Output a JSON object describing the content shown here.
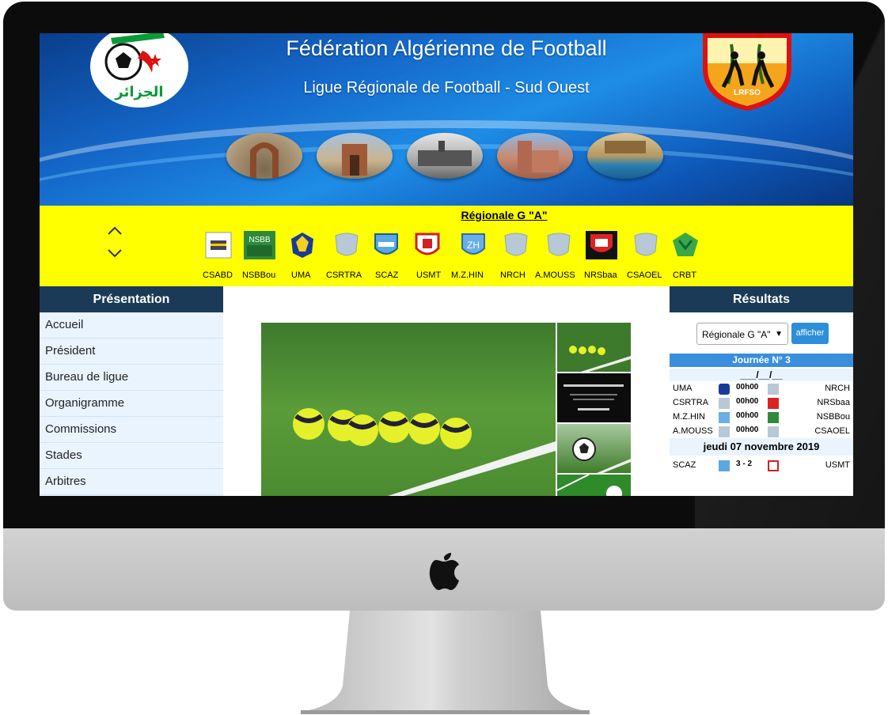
{
  "header": {
    "title": "Fédération Algérienne de Football",
    "subtitle": "Ligue Régionale de Football - Sud Ouest",
    "faf_logo_text": "الجزائر",
    "lrfso_logo_text": "LRFSO"
  },
  "clubs_band": {
    "division_title": "Régionale G \"A\"",
    "clubs": [
      "CSABD",
      "NSBBou",
      "UMA",
      "CSRTRA",
      "SCAZ",
      "USMT",
      "M.Z.HIN",
      "NRCH",
      "A.MOUSS",
      "NRSbaa",
      "CSAOEL",
      "CRBT"
    ]
  },
  "left_menu": {
    "heading": "Présentation",
    "items": [
      "Accueil",
      "Président",
      "Bureau de ligue",
      "Organigramme",
      "Commissions",
      "Stades",
      "Arbitres"
    ]
  },
  "results": {
    "heading": "Résultats",
    "select_value": "Régionale G \"A\"",
    "afficher_label": "afficher",
    "journee": "Journée N° 3",
    "date_blank": "___/__/__",
    "matches": [
      {
        "home": "UMA",
        "score": "00h00",
        "away": "NRCH"
      },
      {
        "home": "CSRTRA",
        "score": "00h00",
        "away": "NRSbaa"
      },
      {
        "home": "M.Z.HIN",
        "score": "00h00",
        "away": "NSBBou"
      },
      {
        "home": "A.MOUSS",
        "score": "00h00",
        "away": "CSAOEL"
      }
    ],
    "date_played": "jeudi 07 novembre 2019",
    "played": [
      {
        "home": "SCAZ",
        "score": "3 - 2",
        "away": "USMT"
      }
    ]
  },
  "colors": {
    "band_yellow": "#ffff00",
    "sidebar_header": "#1b3a57",
    "accent_blue": "#3a8fdc"
  }
}
